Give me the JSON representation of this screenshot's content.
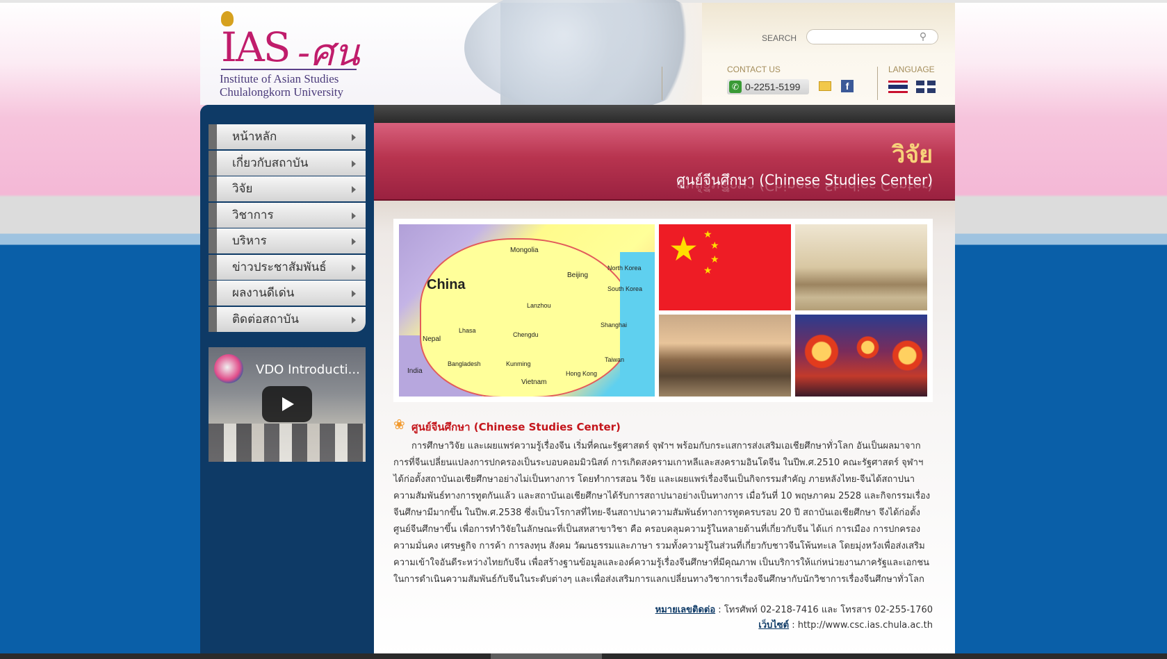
{
  "header": {
    "logo_ias": "IAS",
    "logo_script": "-ศน",
    "institute_line1": "Institute of Asian Studies",
    "institute_line2": "Chulalongkorn University",
    "search_label": "SEARCH",
    "search_placeholder": "",
    "contact_label": "CONTACT US",
    "phone": "0-2251-5199",
    "facebook_glyph": "f",
    "language_label": "LANGUAGE"
  },
  "sidebar": {
    "menu": [
      {
        "label": "หน้าหลัก"
      },
      {
        "label": "เกี่ยวกับสถาบัน"
      },
      {
        "label": "วิจัย"
      },
      {
        "label": "วิชาการ"
      },
      {
        "label": "บริหาร"
      },
      {
        "label": "ข่าวประชาสัมพันธ์"
      },
      {
        "label": "ผลงานดีเด่น"
      },
      {
        "label": "ติดต่อสถาบัน"
      }
    ],
    "video_title": "VDO Introducti..."
  },
  "banner": {
    "title": "วิจัย",
    "subtitle": "ศูนย์จีนศึกษา (Chinese Studies Center)"
  },
  "map_labels": {
    "china": "China",
    "mongolia": "Mongolia",
    "beijing": "Beijing",
    "nepal": "Nepal",
    "india": "India",
    "vietnam": "Vietnam",
    "bangladesh": "Bangladesh",
    "north_korea": "North Korea",
    "south_korea": "South Korea",
    "taiwan": "Taiwan",
    "hong_kong": "Hong Kong",
    "shanghai": "Shanghai",
    "lhasa": "Lhasa",
    "kunming": "Kunming",
    "chengdu": "Chengdu",
    "lanzhou": "Lanzhou"
  },
  "article": {
    "heading": "ศูนย์จีนศึกษา (Chinese Studies Center)",
    "body": "การศึกษาวิจัย และเผยแพร่ความรู้เรื่องจีน เริ่มที่คณะรัฐศาสตร์ จุฬาฯ พร้อมกับกระแสการส่งเสริมเอเชียศึกษาทั่วโลก อันเป็นผลมาจากการที่จีนเปลี่ยนแปลงการปกครองเป็นระบอบคอมมิวนิสต์ การเกิดสงครามเกาหลีและสงครามอินโดจีน ในปีพ.ศ.2510 คณะรัฐศาสตร์ จุฬาฯ ได้ก่อตั้งสถาบันเอเชียศึกษาอย่างไม่เป็นทางการ โดยทำการสอน วิจัย และเผยแพร่เรื่องจีนเป็นกิจกรรมสำคัญ ภายหลังไทย-จีนได้สถาปนาความสัมพันธ์ทางการทูตกันแล้ว และสถาบันเอเชียศึกษาได้รับการสถาปนาอย่างเป็นทางการ เมื่อวันที่ 10 พฤษภาคม 2528 และกิจกรรมเรื่องจีนศึกษามีมากขึ้น ในปีพ.ศ.2538 ซึ่งเป็นวโรกาสที่ไทย-จีนสถาปนาความสัมพันธ์ทางการทูตครบรอบ 20 ปี สถาบันเอเชียศึกษา จึงได้ก่อตั้งศูนย์จีนศึกษาขึ้น เพื่อการทำวิจัยในลักษณะที่เป็นสหสาขาวิชา คือ ครอบคลุมความรู้ในหลายด้านที่เกี่ยวกับจีน ได้แก่ การเมือง การปกครอง ความมั่นคง เศรษฐกิจ การค้า การลงทุน สังคม วัฒนธรรมและภาษา รวมทั้งความรู้ในส่วนที่เกี่ยวกับชาวจีนโพ้นทะเล โดยมุ่งหวังเพื่อส่งเสริมความเข้าใจอันดีระหว่างไทยกับจีน เพื่อสร้างฐานข้อมูลและองค์ความรู้เรื่องจีนศึกษาที่มีคุณภาพ เป็นบริการให้แก่หน่วยงานภาครัฐและเอกชนในการดำเนินความสัมพันธ์กับจีนในระดับต่างๆ และเพื่อส่งเสริมการแลกเปลี่ยนทางวิชาการเรื่องจีนศึกษากับนักวิชาการเรื่องจีนศึกษาทั่วโลก",
    "phone_label": "หมายเลขติดต่อ",
    "phone_value": " : โทรศัพท์ 02-218-7416 และ โทรสาร 02-255-1760",
    "website_label": "เว็บไซต์",
    "website_value": " : http://www.csc.ias.chula.ac.th"
  }
}
